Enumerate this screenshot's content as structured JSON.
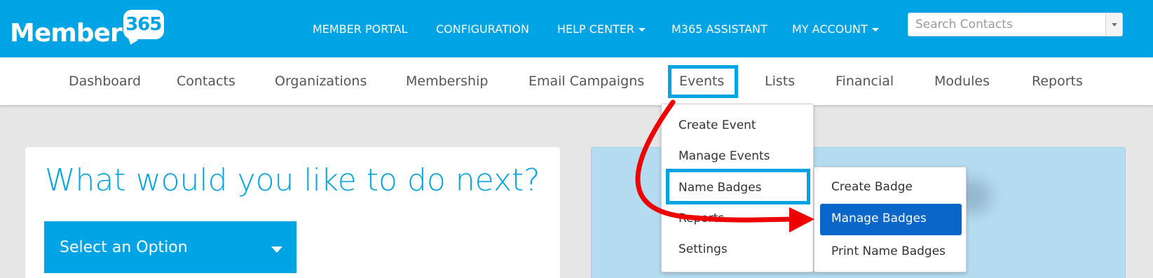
{
  "logo": {
    "word": "Member",
    "number": "365"
  },
  "topnav": {
    "member_portal": "MEMBER PORTAL",
    "configuration": "CONFIGURATION",
    "help_center": "HELP CENTER",
    "assistant": "M365 ASSISTANT",
    "my_account": "MY ACCOUNT"
  },
  "search": {
    "placeholder": "Search Contacts"
  },
  "mainnav": {
    "dashboard": "Dashboard",
    "contacts": "Contacts",
    "organizations": "Organizations",
    "membership": "Membership",
    "email_campaigns": "Email Campaigns",
    "events": "Events",
    "lists": "Lists",
    "financial": "Financial",
    "modules": "Modules",
    "reports": "Reports"
  },
  "events_menu": {
    "create_event": "Create Event",
    "manage_events": "Manage Events",
    "name_badges": "Name Badges",
    "reports": "Reports",
    "settings": "Settings"
  },
  "badges_menu": {
    "create_badge": "Create Badge",
    "manage_badges": "Manage Badges",
    "print_name_badges": "Print Name Badges"
  },
  "main": {
    "prompt": "What would you like to do next?",
    "select_label": "Select an Option"
  },
  "colors": {
    "brand_blue": "#00a4e4",
    "active_blue": "#0a66c8",
    "annotation_red": "#ee0000"
  }
}
